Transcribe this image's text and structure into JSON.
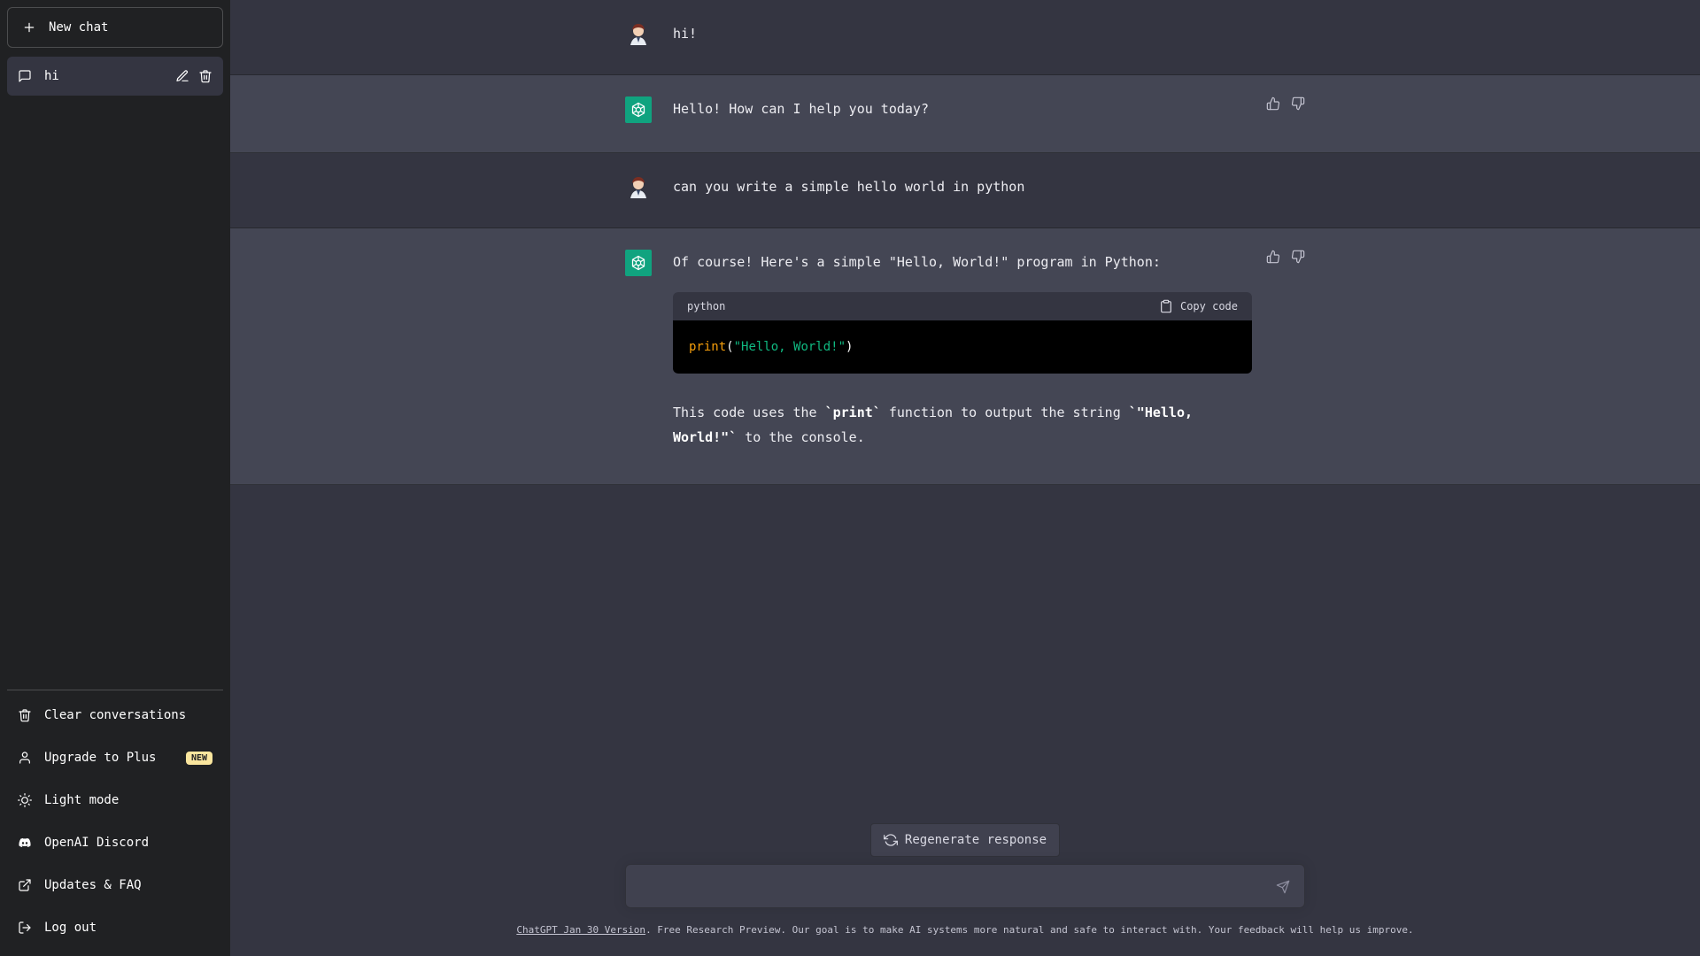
{
  "sidebar": {
    "new_chat_label": "New chat",
    "conversations": [
      {
        "label": "hi"
      }
    ],
    "menu": [
      {
        "label": "Clear conversations",
        "icon": "trash-icon"
      },
      {
        "label": "Upgrade to Plus",
        "icon": "user-icon",
        "badge": "NEW"
      },
      {
        "label": "Light mode",
        "icon": "sun-icon"
      },
      {
        "label": "OpenAI Discord",
        "icon": "discord-icon"
      },
      {
        "label": "Updates & FAQ",
        "icon": "external-link-icon"
      },
      {
        "label": "Log out",
        "icon": "logout-icon"
      }
    ]
  },
  "messages": [
    {
      "role": "user",
      "text": "hi!"
    },
    {
      "role": "assistant",
      "text": "Hello! How can I help you today?"
    },
    {
      "role": "user",
      "text": "can you write a simple hello world in python"
    },
    {
      "role": "assistant",
      "text": "Of course! Here's a simple \"Hello, World!\" program in Python:",
      "code": {
        "language": "python",
        "copy_label": "Copy code",
        "fn": "print",
        "open": "(",
        "str": "\"Hello, World!\"",
        "close": ")"
      },
      "para": {
        "p1": "This code uses the ",
        "b1": "`print`",
        "p2": " function to output the string ",
        "b2": "`\"Hello, World!\"`",
        "p3": " to the console."
      }
    }
  ],
  "regenerate_label": "Regenerate response",
  "input": {
    "placeholder": ""
  },
  "footer": {
    "link": "ChatGPT Jan 30 Version",
    "text": ". Free Research Preview. Our goal is to make AI systems more natural and safe to interact with. Your feedback will help us improve."
  },
  "colors": {
    "accent": "#10a37f",
    "sidebar": "#202123",
    "main": "#343541",
    "bot_row": "#444654",
    "badge": "#fae69e"
  }
}
